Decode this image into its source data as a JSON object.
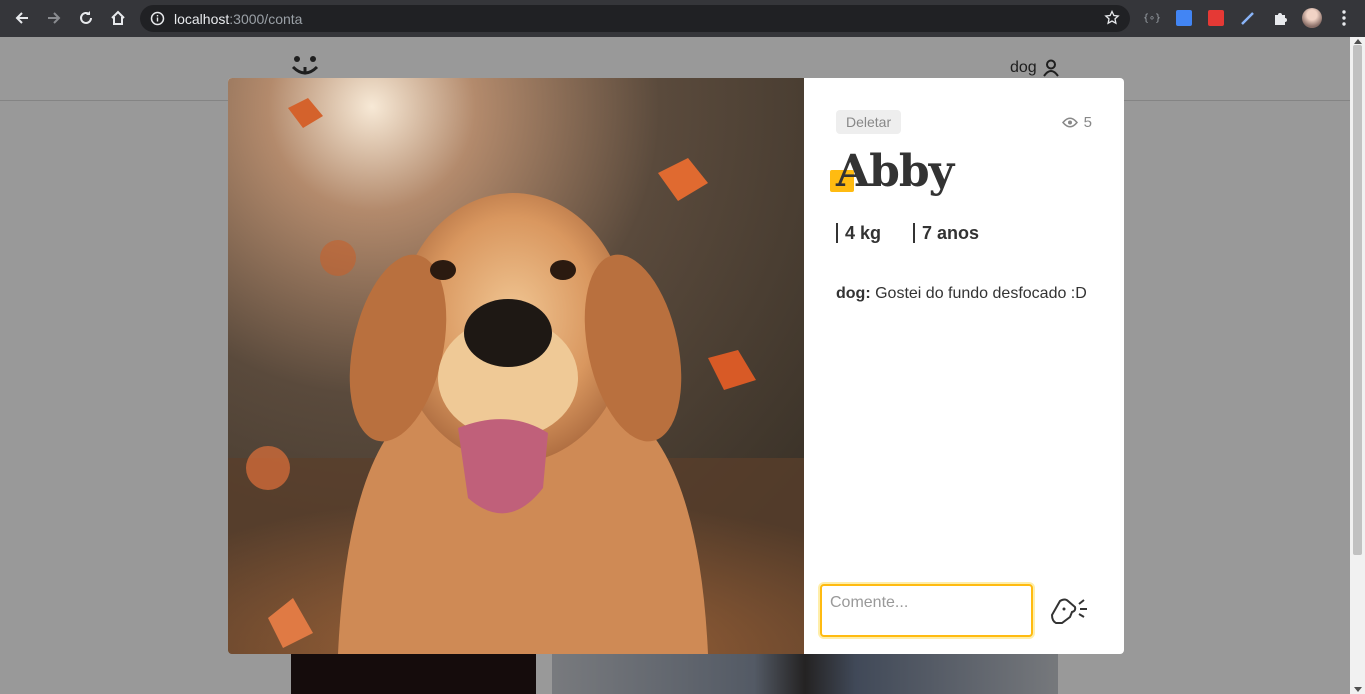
{
  "browser": {
    "url_host": "localhost",
    "url_path": ":3000/conta"
  },
  "header": {
    "user_label": "dog"
  },
  "photo": {
    "alt": "Abby"
  },
  "modal": {
    "delete_label": "Deletar",
    "views_count": "5",
    "title": "Abby",
    "weight": "4 kg",
    "age": "7 anos",
    "comments": [
      {
        "author": "dog:",
        "text": "Gostei do fundo desfocado :D"
      }
    ],
    "comment_placeholder": "Comente..."
  },
  "colors": {
    "accent": "#ffbb11",
    "overlay": "rgba(0,0,0,0.4)"
  }
}
